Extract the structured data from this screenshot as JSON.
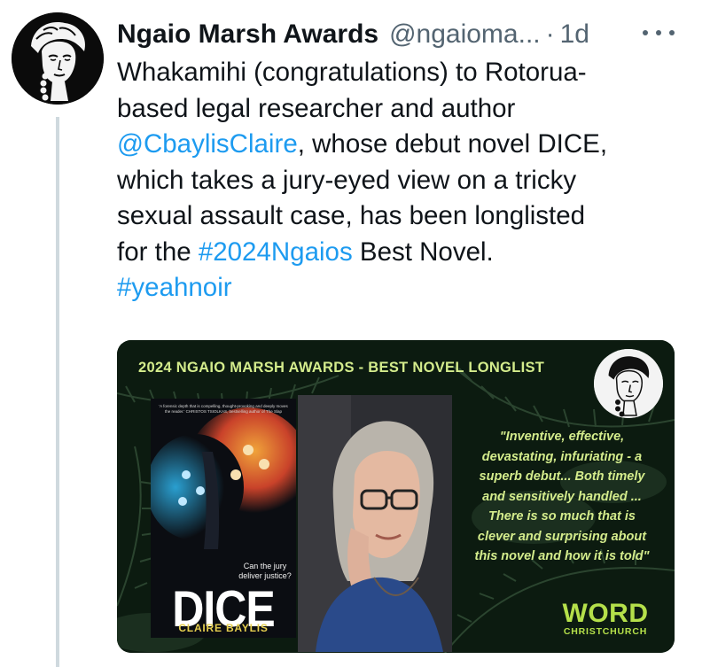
{
  "tweet": {
    "display_name": "Ngaio Marsh Awards",
    "handle": "@ngaioma...",
    "separator": "·",
    "time": "1d",
    "text_lines": [
      [
        {
          "t": "Whakamihi (congratulations) to Rotorua-"
        }
      ],
      [
        {
          "t": "based legal researcher and author"
        }
      ],
      [
        {
          "t": "@CbaylisClaire",
          "link": true
        },
        {
          "t": ", whose debut novel DICE,"
        }
      ],
      [
        {
          "t": "which takes a jury-eyed view on a tricky"
        }
      ],
      [
        {
          "t": "sexual assault case, has been longlisted"
        }
      ],
      [
        {
          "t": "for the "
        },
        {
          "t": "#2024Ngaios",
          "link": true
        },
        {
          "t": " Best Novel."
        }
      ],
      [
        {
          "t": "#yeahnoir",
          "link": true
        }
      ]
    ]
  },
  "media": {
    "banner": "2024 NGAIO MARSH AWARDS - BEST NOVEL LONGLIST",
    "book": {
      "blurb": "'A forensic depth that is compelling, thought-provoking and deeply moves the reader.' CHRISTOS TSIOLKAS, bestselling author of The Slap",
      "tagline": "Can the jury deliver justice?",
      "title": "DICE",
      "author": "CLAIRE BAYLIS"
    },
    "quote_lines": [
      "\"Inventive, effective,",
      "devastating, infuriating - a",
      "superb debut... Both timely",
      "and sensitively handled ...",
      "There is so much that is",
      "clever and surprising about",
      "this novel and how it is told\""
    ],
    "logo_main": "WORD",
    "logo_sub": "CHRISTCHURCH"
  },
  "icons": {
    "avatar": "ngaio-marsh-portrait-icon",
    "more": "more-options-icon"
  },
  "colors": {
    "text": "#0f1419",
    "secondary": "#536471",
    "link": "#1d9bf0",
    "accent_green": "#d4ec8c"
  }
}
